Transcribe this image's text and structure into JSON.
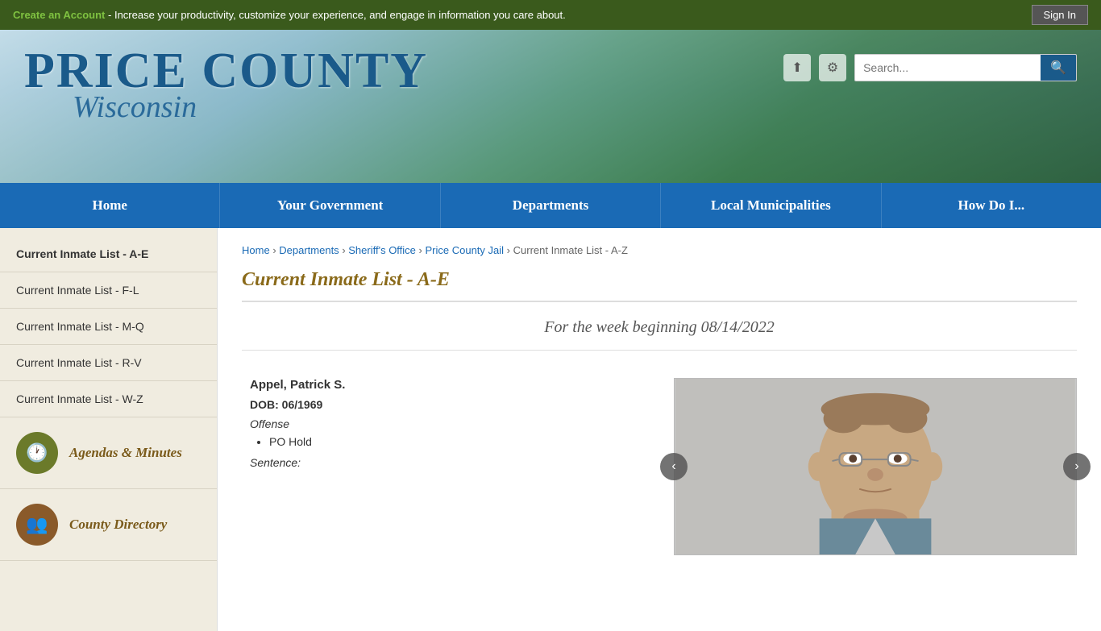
{
  "topbar": {
    "create_account_text": "Create an Account",
    "tagline": " - Increase your productivity, customize your experience, and engage in information you care about.",
    "sign_in_label": "Sign In"
  },
  "header": {
    "logo_title": "PRICE COUNTY",
    "logo_subtitle": "Wisconsin",
    "search_placeholder": "Search...",
    "search_label": "Search"
  },
  "nav": {
    "items": [
      {
        "label": "Home",
        "id": "home"
      },
      {
        "label": "Your Government",
        "id": "your-government"
      },
      {
        "label": "Departments",
        "id": "departments"
      },
      {
        "label": "Local Municipalities",
        "id": "local-municipalities"
      },
      {
        "label": "How Do I...",
        "id": "how-do-i"
      }
    ]
  },
  "sidebar": {
    "nav_items": [
      {
        "label": "Current Inmate List - A-E",
        "id": "ae",
        "active": true
      },
      {
        "label": "Current Inmate List - F-L",
        "id": "fl"
      },
      {
        "label": "Current Inmate List - M-Q",
        "id": "mq"
      },
      {
        "label": "Current Inmate List - R-V",
        "id": "rv"
      },
      {
        "label": "Current Inmate List - W-Z",
        "id": "wz"
      }
    ],
    "widgets": [
      {
        "label": "Agendas & Minutes",
        "icon": "🕐",
        "icon_style": "olive",
        "id": "agendas"
      },
      {
        "label": "County Directory",
        "icon": "👥",
        "icon_style": "brown",
        "id": "county-directory"
      }
    ]
  },
  "breadcrumb": {
    "items": [
      {
        "label": "Home",
        "href": "#"
      },
      {
        "label": "Departments",
        "href": "#"
      },
      {
        "label": "Sheriff's Office",
        "href": "#"
      },
      {
        "label": "Price County Jail",
        "href": "#"
      },
      {
        "label": "Current Inmate List - A-Z",
        "href": null
      }
    ]
  },
  "content": {
    "page_title": "Current Inmate List - A-E",
    "week_heading": "For the week beginning 08/14/2022",
    "inmate": {
      "name": "Appel, Patrick S.",
      "dob_label": "DOB:",
      "dob": "06/1969",
      "offense_label": "Offense",
      "offenses": [
        "PO Hold"
      ],
      "sentence_label": "Sentence:"
    }
  }
}
